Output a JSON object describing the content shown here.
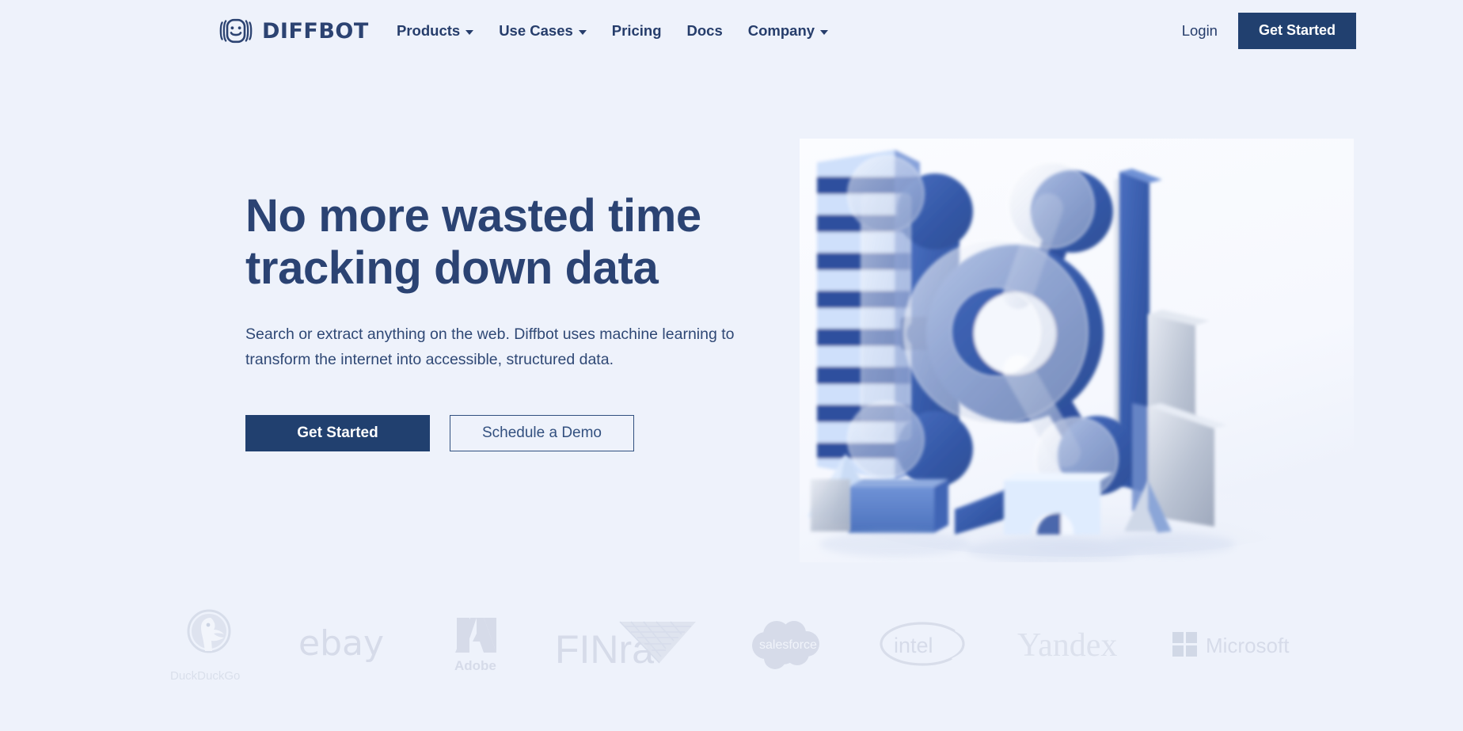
{
  "theme": {
    "page_background": "#eef2fb",
    "brand_navy": "#2c4372",
    "button_navy": "#21406f",
    "body_text": "#2f4875",
    "logo_gray": "#d4dae8"
  },
  "navbar": {
    "brand": {
      "icon": "diffbot-robot-logo",
      "wordmark": "DIFFBOT"
    },
    "links": [
      {
        "label": "Products",
        "has_dropdown": true
      },
      {
        "label": "Use Cases",
        "has_dropdown": true
      },
      {
        "label": "Pricing",
        "has_dropdown": false
      },
      {
        "label": "Docs",
        "has_dropdown": false
      },
      {
        "label": "Company",
        "has_dropdown": true
      }
    ],
    "login_label": "Login",
    "cta_label": "Get Started"
  },
  "hero": {
    "title_line1": "No more wasted time",
    "title_line2": "tracking down data",
    "subtitle": "Search or extract anything on the web. Diffbot uses machine learning to transform the internet into accessible, structured data.",
    "primary_cta": "Get Started",
    "secondary_cta": "Schedule a Demo",
    "illustration_alt": "3d-abstract-blue-shapes-illustration"
  },
  "logos": [
    {
      "name": "DuckDuckGo",
      "icon": "duckduckgo-logo"
    },
    {
      "name": "ebay",
      "icon": "ebay-logo"
    },
    {
      "name": "Adobe",
      "icon": "adobe-logo"
    },
    {
      "name": "FINRA",
      "icon": "finra-logo"
    },
    {
      "name": "salesforce",
      "icon": "salesforce-logo"
    },
    {
      "name": "intel",
      "icon": "intel-logo"
    },
    {
      "name": "Yandex",
      "icon": "yandex-logo"
    },
    {
      "name": "Microsoft",
      "icon": "microsoft-logo"
    }
  ]
}
